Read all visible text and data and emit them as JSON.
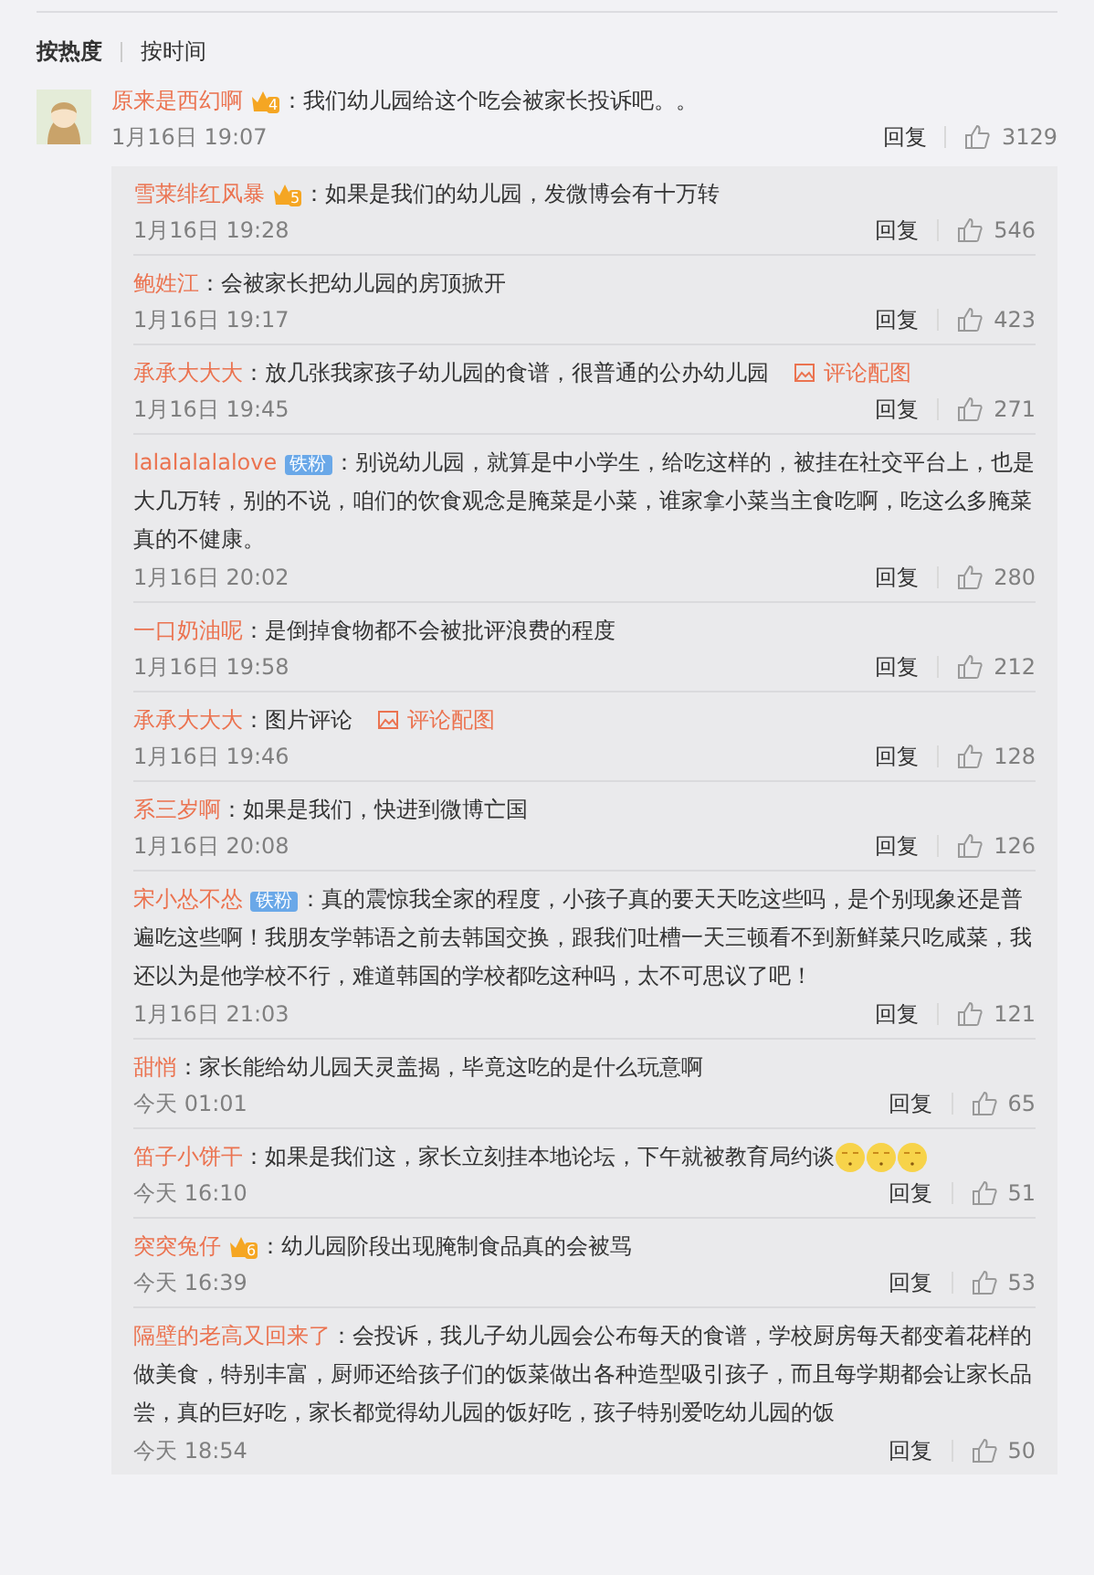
{
  "sort_tabs": [
    {
      "label": "按热度",
      "selected": true
    },
    {
      "label": "按时间",
      "selected": false
    }
  ],
  "comment": {
    "user": "原来是西幻啊",
    "badge": {
      "kind": "vip",
      "label": "4"
    },
    "text": "：我们幼儿园给这个吃会被家长投诉吧。。",
    "time": "1月16日 19:07",
    "reply_label": "回复",
    "likes": "3129"
  },
  "replies": [
    {
      "user": "雪莱绯红风暴",
      "badge": {
        "kind": "vip",
        "label": "5"
      },
      "text": "：如果是我们的幼儿园，发微博会有十万转",
      "time": "1月16日 19:28",
      "reply_label": "回复",
      "likes": "546"
    },
    {
      "user": "鲍姓江",
      "text": "：会被家长把幼儿园的房顶掀开",
      "time": "1月16日 19:17",
      "reply_label": "回复",
      "likes": "423"
    },
    {
      "user": "承承大大大",
      "text": "：放几张我家孩子幼儿园的食谱，很普通的公办幼儿园",
      "image_link": "评论配图",
      "time": "1月16日 19:45",
      "reply_label": "回复",
      "likes": "271"
    },
    {
      "user": "lalalalalalove",
      "badge": {
        "kind": "fan",
        "label": "铁粉"
      },
      "text": "：别说幼儿园，就算是中小学生，给吃这样的，被挂在社交平台上，也是大几万转，别的不说，咱们的饮食观念是腌菜是小菜，谁家拿小菜当主食吃啊，吃这么多腌菜真的不健康。",
      "time": "1月16日 20:02",
      "reply_label": "回复",
      "likes": "280"
    },
    {
      "user": "一口奶油呢",
      "text": "：是倒掉食物都不会被批评浪费的程度",
      "time": "1月16日 19:58",
      "reply_label": "回复",
      "likes": "212"
    },
    {
      "user": "承承大大大",
      "text": "：图片评论",
      "image_link": "评论配图",
      "time": "1月16日 19:46",
      "reply_label": "回复",
      "likes": "128"
    },
    {
      "user": "系三岁啊",
      "text": "：如果是我们，快进到微博亡国",
      "time": "1月16日 20:08",
      "reply_label": "回复",
      "likes": "126"
    },
    {
      "user": "宋小怂不怂",
      "badge": {
        "kind": "fan",
        "label": "铁粉"
      },
      "text": "：真的震惊我全家的程度，小孩子真的要天天吃这些吗，是个别现象还是普遍吃这些啊！我朋友学韩语之前去韩国交换，跟我们吐槽一天三顿看不到新鲜菜只吃咸菜，我还以为是他学校不行，难道韩国的学校都吃这种吗，太不可思议了吧！",
      "time": "1月16日 21:03",
      "reply_label": "回复",
      "likes": "121"
    },
    {
      "user": "甜悄",
      "text": "：家长能给幼儿园天灵盖揭，毕竟这吃的是什么玩意啊",
      "time": "今天 01:01",
      "reply_label": "回复",
      "likes": "65"
    },
    {
      "user": "笛子小饼干",
      "text": "：如果是我们这，家长立刻挂本地论坛，下午就被教育局约谈",
      "emojis": [
        {
          "kind": "face"
        },
        {
          "kind": "face"
        },
        {
          "kind": "face"
        }
      ],
      "time": "今天 16:10",
      "reply_label": "回复",
      "likes": "51"
    },
    {
      "user": "突突兔仔",
      "badge": {
        "kind": "vip",
        "label": "6"
      },
      "text": "：幼儿园阶段出现腌制食品真的会被骂",
      "time": "今天 16:39",
      "reply_label": "回复",
      "likes": "53"
    },
    {
      "user": "隔壁的老高又回来了",
      "text": "：会投诉，我儿子幼儿园会公布每天的食谱，学校厨房每天都变着花样的做美食，特别丰富，厨师还给孩子们的饭菜做出各种造型吸引孩子，而且每学期都会让家长品尝，真的巨好吃，家长都觉得幼儿园的饭好吃，孩子特别爱吃幼儿园的饭",
      "time": "今天 18:54",
      "reply_label": "回复",
      "likes": "50"
    }
  ]
}
